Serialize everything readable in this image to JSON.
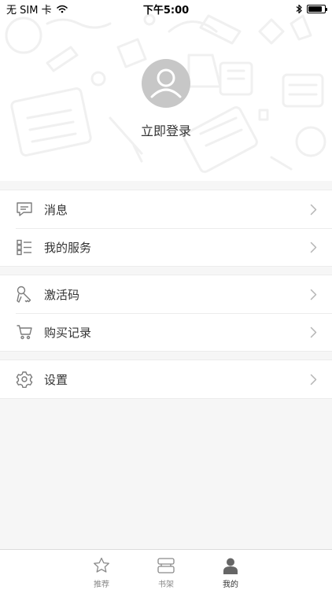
{
  "status_bar": {
    "carrier": "无 SIM 卡",
    "time": "下午5:00",
    "battery_level": 0.85
  },
  "profile": {
    "avatar_icon": "user-avatar-icon",
    "login_label": "立即登录"
  },
  "menu": {
    "group1": [
      {
        "label": "消息",
        "icon": "message-icon"
      },
      {
        "label": "我的服务",
        "icon": "service-list-icon"
      }
    ],
    "group2": [
      {
        "label": "激活码",
        "icon": "key-icon"
      },
      {
        "label": "购买记录",
        "icon": "cart-icon"
      }
    ],
    "group3": [
      {
        "label": "设置",
        "icon": "gear-icon"
      }
    ]
  },
  "tab_bar": {
    "tabs": [
      {
        "label": "推荐",
        "icon": "star-icon",
        "active": false
      },
      {
        "label": "书架",
        "icon": "bookshelf-icon",
        "active": false
      },
      {
        "label": "我的",
        "icon": "person-icon",
        "active": true
      }
    ]
  },
  "colors": {
    "background": "#f6f6f6",
    "avatar": "#c7c7c7",
    "divider": "#ececec",
    "icon_gray": "#7a7a7a"
  }
}
